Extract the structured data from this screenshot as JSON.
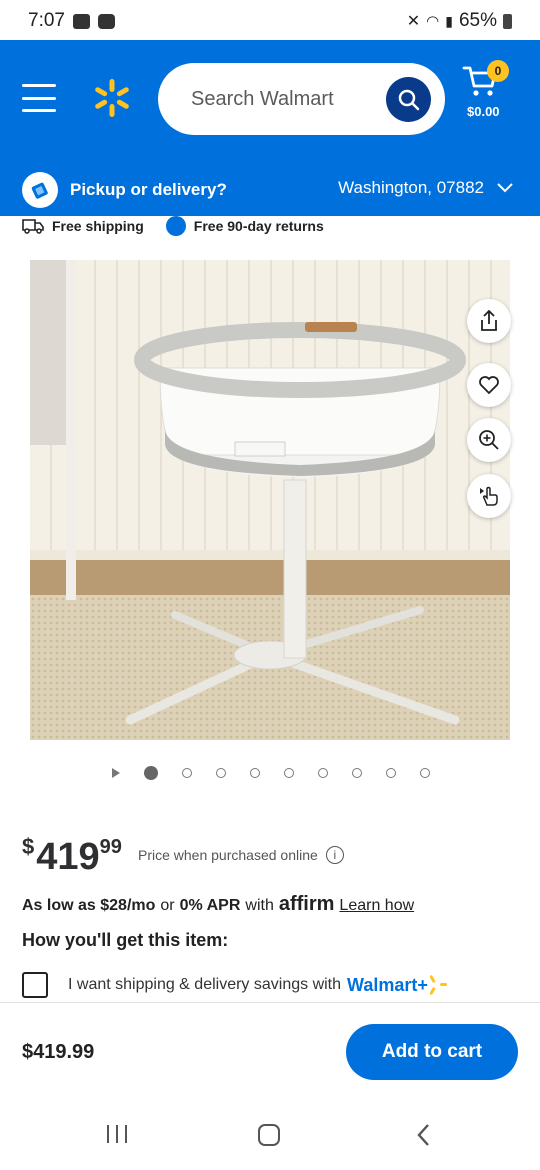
{
  "status": {
    "time": "7:07",
    "battery": "65%"
  },
  "header": {
    "search_placeholder": "Search Walmart",
    "cart_count": "0",
    "cart_total": "$0.00",
    "pickup_label": "Pickup or delivery?",
    "location": "Washington, 07882"
  },
  "shipping": {
    "free_shipping": "Free shipping",
    "free_returns": "Free 90-day returns"
  },
  "gallery": {
    "dot_count": 9,
    "active_index": 0
  },
  "product": {
    "price_currency": "$",
    "price_whole": "419",
    "price_cents": "99",
    "price_note": "Price when purchased online",
    "affirm": {
      "as_low_as": "As low as $28/mo",
      "or": "or",
      "apr": "0% APR",
      "with": "with",
      "brand": "affirm",
      "learn_how": "Learn how"
    },
    "how_get": "How you'll get this item:",
    "walmart_plus_text": "I want shipping & delivery savings with",
    "walmart_plus_brand": "Walmart+"
  },
  "bottom": {
    "price": "$419.99",
    "add_to_cart": "Add to cart"
  },
  "colors": {
    "brand_blue": "#0071dc",
    "spark_yellow": "#ffc220",
    "dark_blue": "#0a3a8a"
  }
}
